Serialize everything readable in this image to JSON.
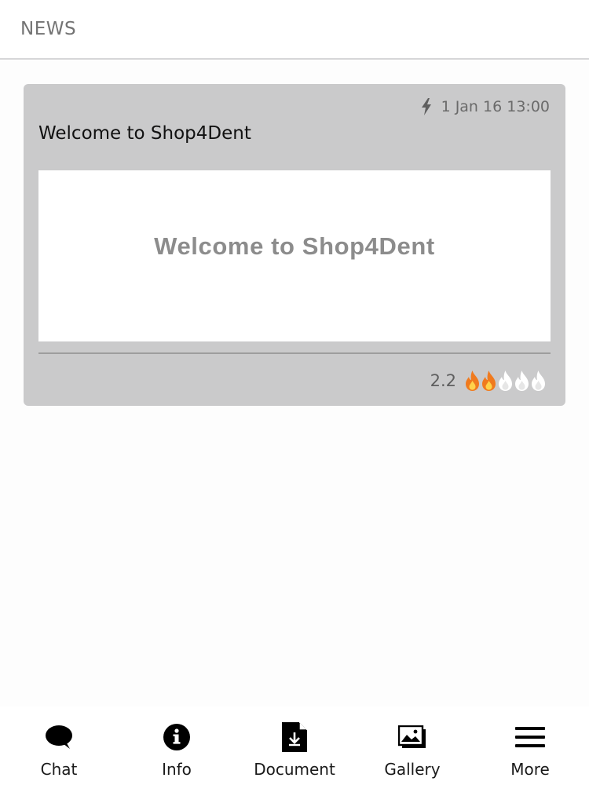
{
  "header": {
    "title": "NEWS"
  },
  "news": {
    "items": [
      {
        "timestamp": "1 Jan 16 13:00",
        "timestamp_icon": "lightning-icon",
        "title": "Welcome to Shop4Dent",
        "banner_text": "Welcome to Shop4Dent",
        "rating": "2.2",
        "rating_icon": "flame-icon",
        "rating_max": 5,
        "rating_filled": 2
      }
    ]
  },
  "tabbar": {
    "tabs": [
      {
        "label": "Chat",
        "icon": "chat-bubble-icon"
      },
      {
        "label": "Info",
        "icon": "info-icon"
      },
      {
        "label": "Document",
        "icon": "document-download-icon"
      },
      {
        "label": "Gallery",
        "icon": "gallery-icon"
      },
      {
        "label": "More",
        "icon": "menu-icon"
      }
    ]
  },
  "colors": {
    "card_background": "#cacacb",
    "flame_active": "#f07a1e",
    "flame_inactive": "#ffffff"
  }
}
